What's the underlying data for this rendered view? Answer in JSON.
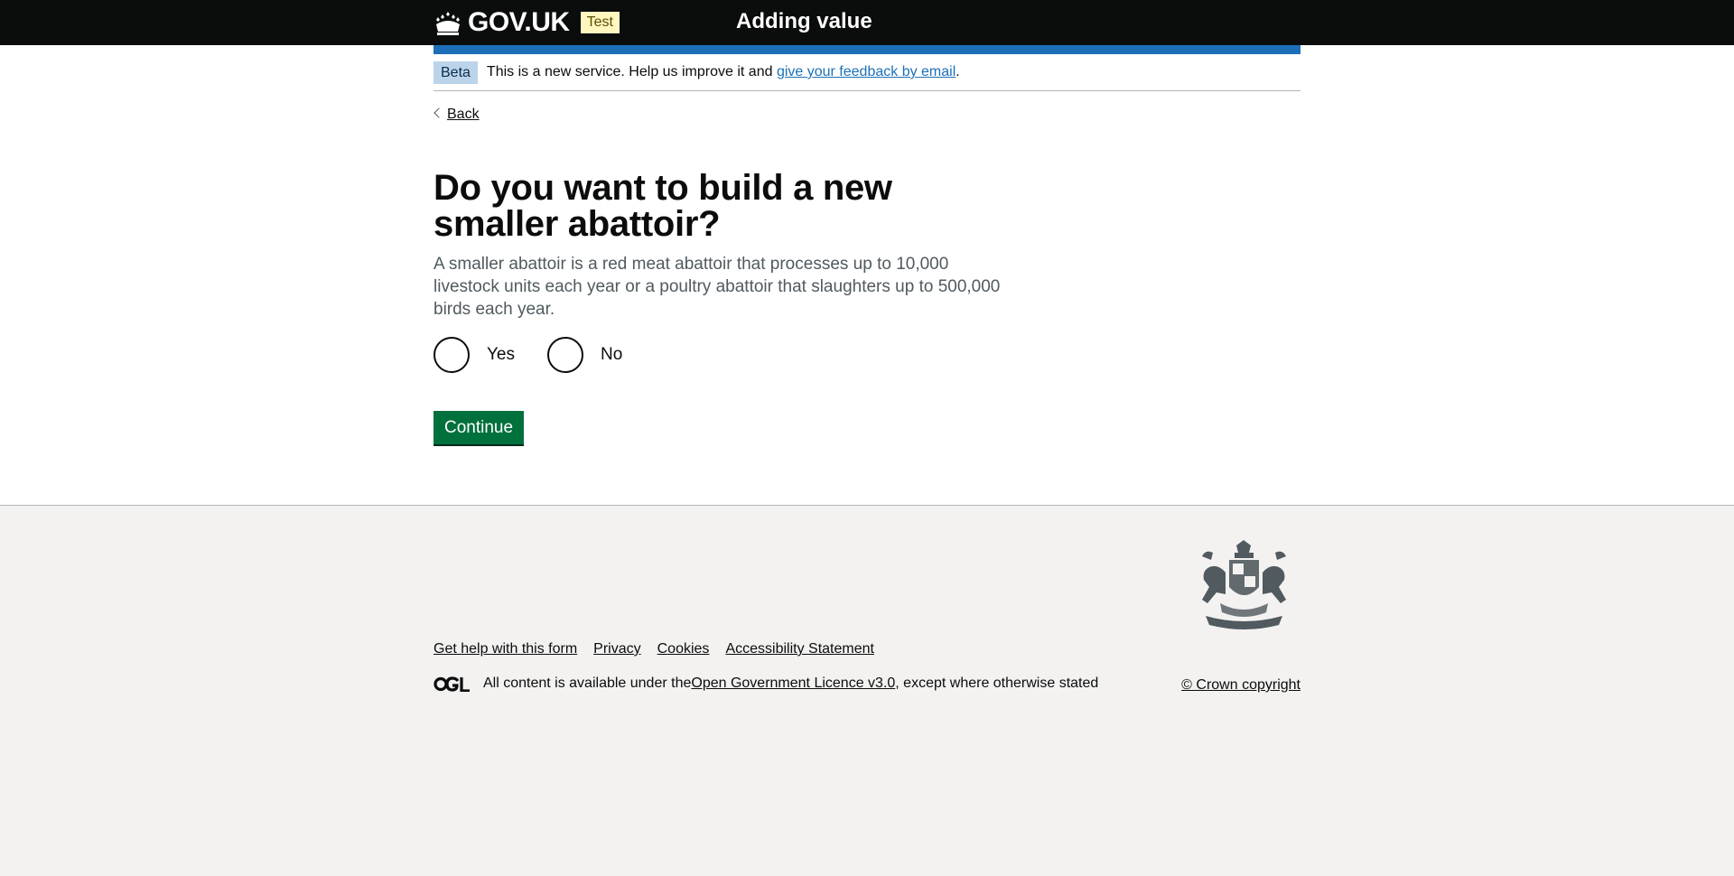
{
  "header": {
    "logo_text": "GOV.UK",
    "env_tag": "Test",
    "service_name": "Adding value"
  },
  "phase_banner": {
    "tag": "Beta",
    "text_before": "This is a new service. Help us improve it and ",
    "link_text": "give your feedback by email",
    "text_after": "."
  },
  "back_link": "Back",
  "question": {
    "title": "Do you want to build a new smaller abattoir?",
    "hint": "A smaller abattoir is a red meat abattoir that processes up to 10,000 livestock units each year or a poultry abattoir that slaughters up to 500,000 birds each year.",
    "options": [
      "Yes",
      "No"
    ]
  },
  "continue_button": "Continue",
  "footer": {
    "links": [
      "Get help with this form",
      "Privacy",
      "Cookies",
      "Accessibility Statement"
    ],
    "licence_before": "All content is available under the ",
    "licence_link": "Open Government Licence v3.0",
    "licence_after": ", except where otherwise stated",
    "copyright": "© Crown copyright"
  },
  "colors": {
    "header_bg": "#0b0c0c",
    "accent_blue": "#1d70b8",
    "button_green": "#00703c",
    "footer_bg": "#f3f2f1"
  },
  "icons": [
    "crown-icon",
    "back-chevron-icon",
    "ogl-logo-icon",
    "royal-coat-of-arms-icon"
  ]
}
